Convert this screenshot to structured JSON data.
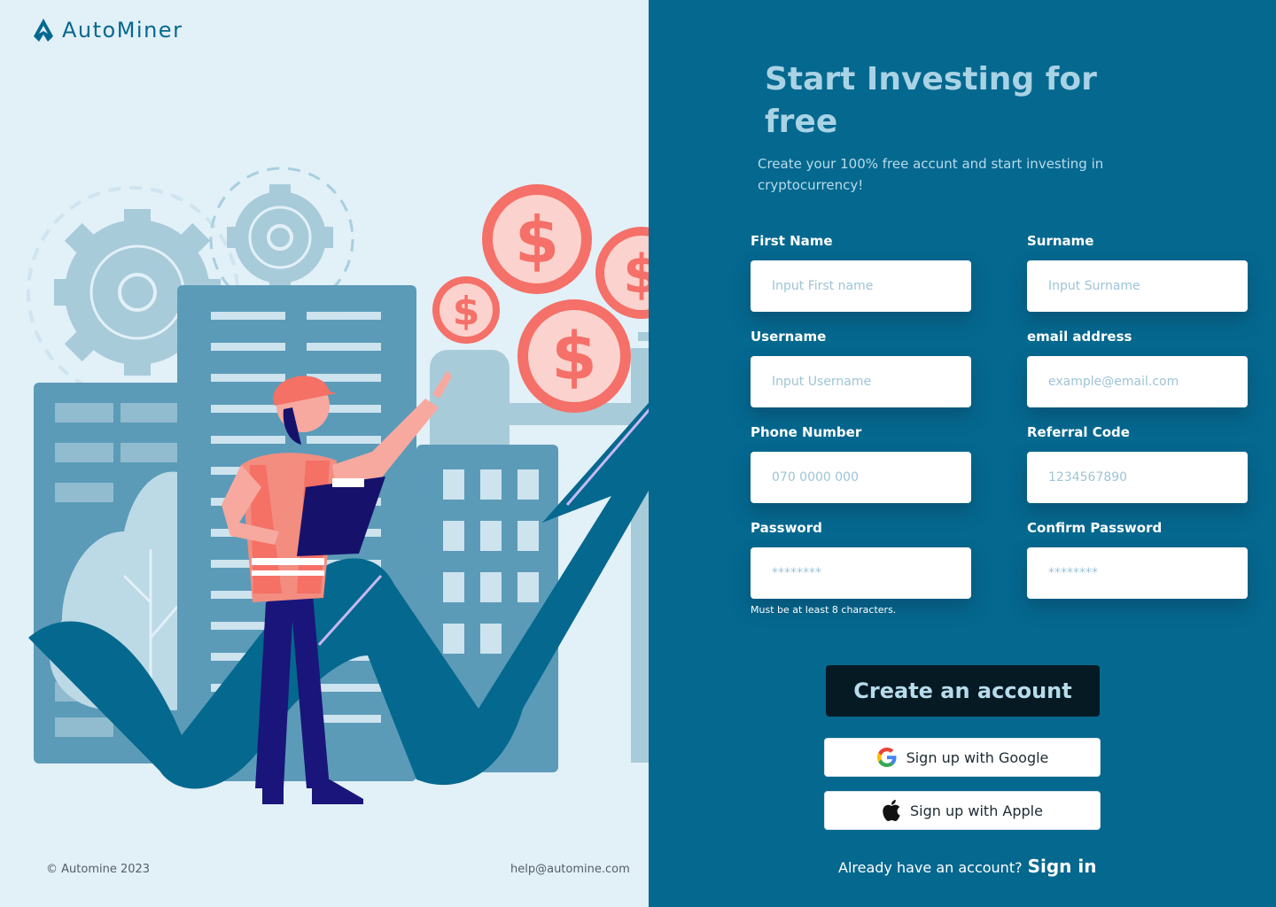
{
  "brand": {
    "name": "AutoMiner"
  },
  "footer": {
    "copyright": "© Automine 2023",
    "email": "help@automine.com"
  },
  "hero": {
    "title": "Start Investing for free",
    "subtitle": "Create your 100% free accunt and start investing in cryptocurrency!"
  },
  "form": {
    "first_name": {
      "label": "First Name",
      "placeholder": "Input First name"
    },
    "surname": {
      "label": "Surname",
      "placeholder": "Input Surname"
    },
    "username": {
      "label": "Username",
      "placeholder": "Input Username"
    },
    "email": {
      "label": "email address",
      "placeholder": "example@email.com"
    },
    "phone": {
      "label": "Phone Number",
      "placeholder": "070 0000 000"
    },
    "referral": {
      "label": "Referral Code",
      "placeholder": "1234567890"
    },
    "password": {
      "label": "Password",
      "placeholder": "********",
      "hint": "Must be at least 8 characters."
    },
    "confirm_password": {
      "label": "Confirm Password",
      "placeholder": "********"
    }
  },
  "actions": {
    "create": "Create an account",
    "google": "Sign up with Google",
    "apple": "Sign up with Apple",
    "signin_prompt": "Already have an account?",
    "signin_link": "Sign in"
  },
  "icons": {
    "logo": "logo-icon",
    "google": "google-icon",
    "apple": "apple-icon",
    "dollar": "dollar-coin-icon",
    "gear": "gear-icon"
  },
  "colors": {
    "primary": "#05688f",
    "left_bg": "#e2f0f8",
    "dark_button": "#061a24",
    "heading": "#a9d3e5",
    "coin": "#f47068"
  }
}
